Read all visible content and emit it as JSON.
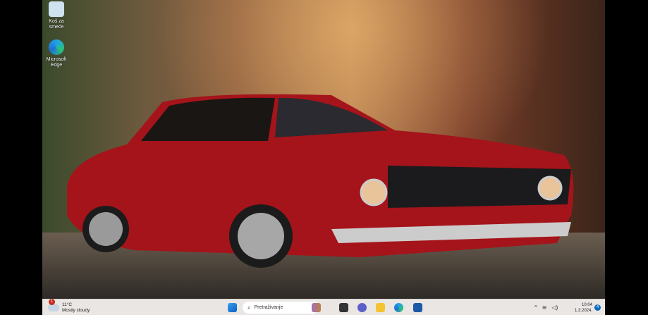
{
  "desktop": {
    "icons": [
      {
        "label": "Koš za smeće",
        "icon": "recycle-bin-icon"
      },
      {
        "label": "Microsoft Edge",
        "icon": "edge-icon"
      }
    ]
  },
  "taskbar": {
    "weather": {
      "temperature": "11°C",
      "condition": "Mostly cloudy",
      "badge": "1"
    },
    "search": {
      "placeholder": "Pretraživanje"
    },
    "apps": [
      "start",
      "search",
      "task-view",
      "teams",
      "file-explorer",
      "edge",
      "store"
    ],
    "tray": {
      "time": "10:04",
      "date": "1.3.2024.",
      "notifications": "4"
    }
  },
  "colors": {
    "taskbar": "#e9e6e4",
    "accent": "#0f6cbd",
    "car": "#b3161b"
  }
}
